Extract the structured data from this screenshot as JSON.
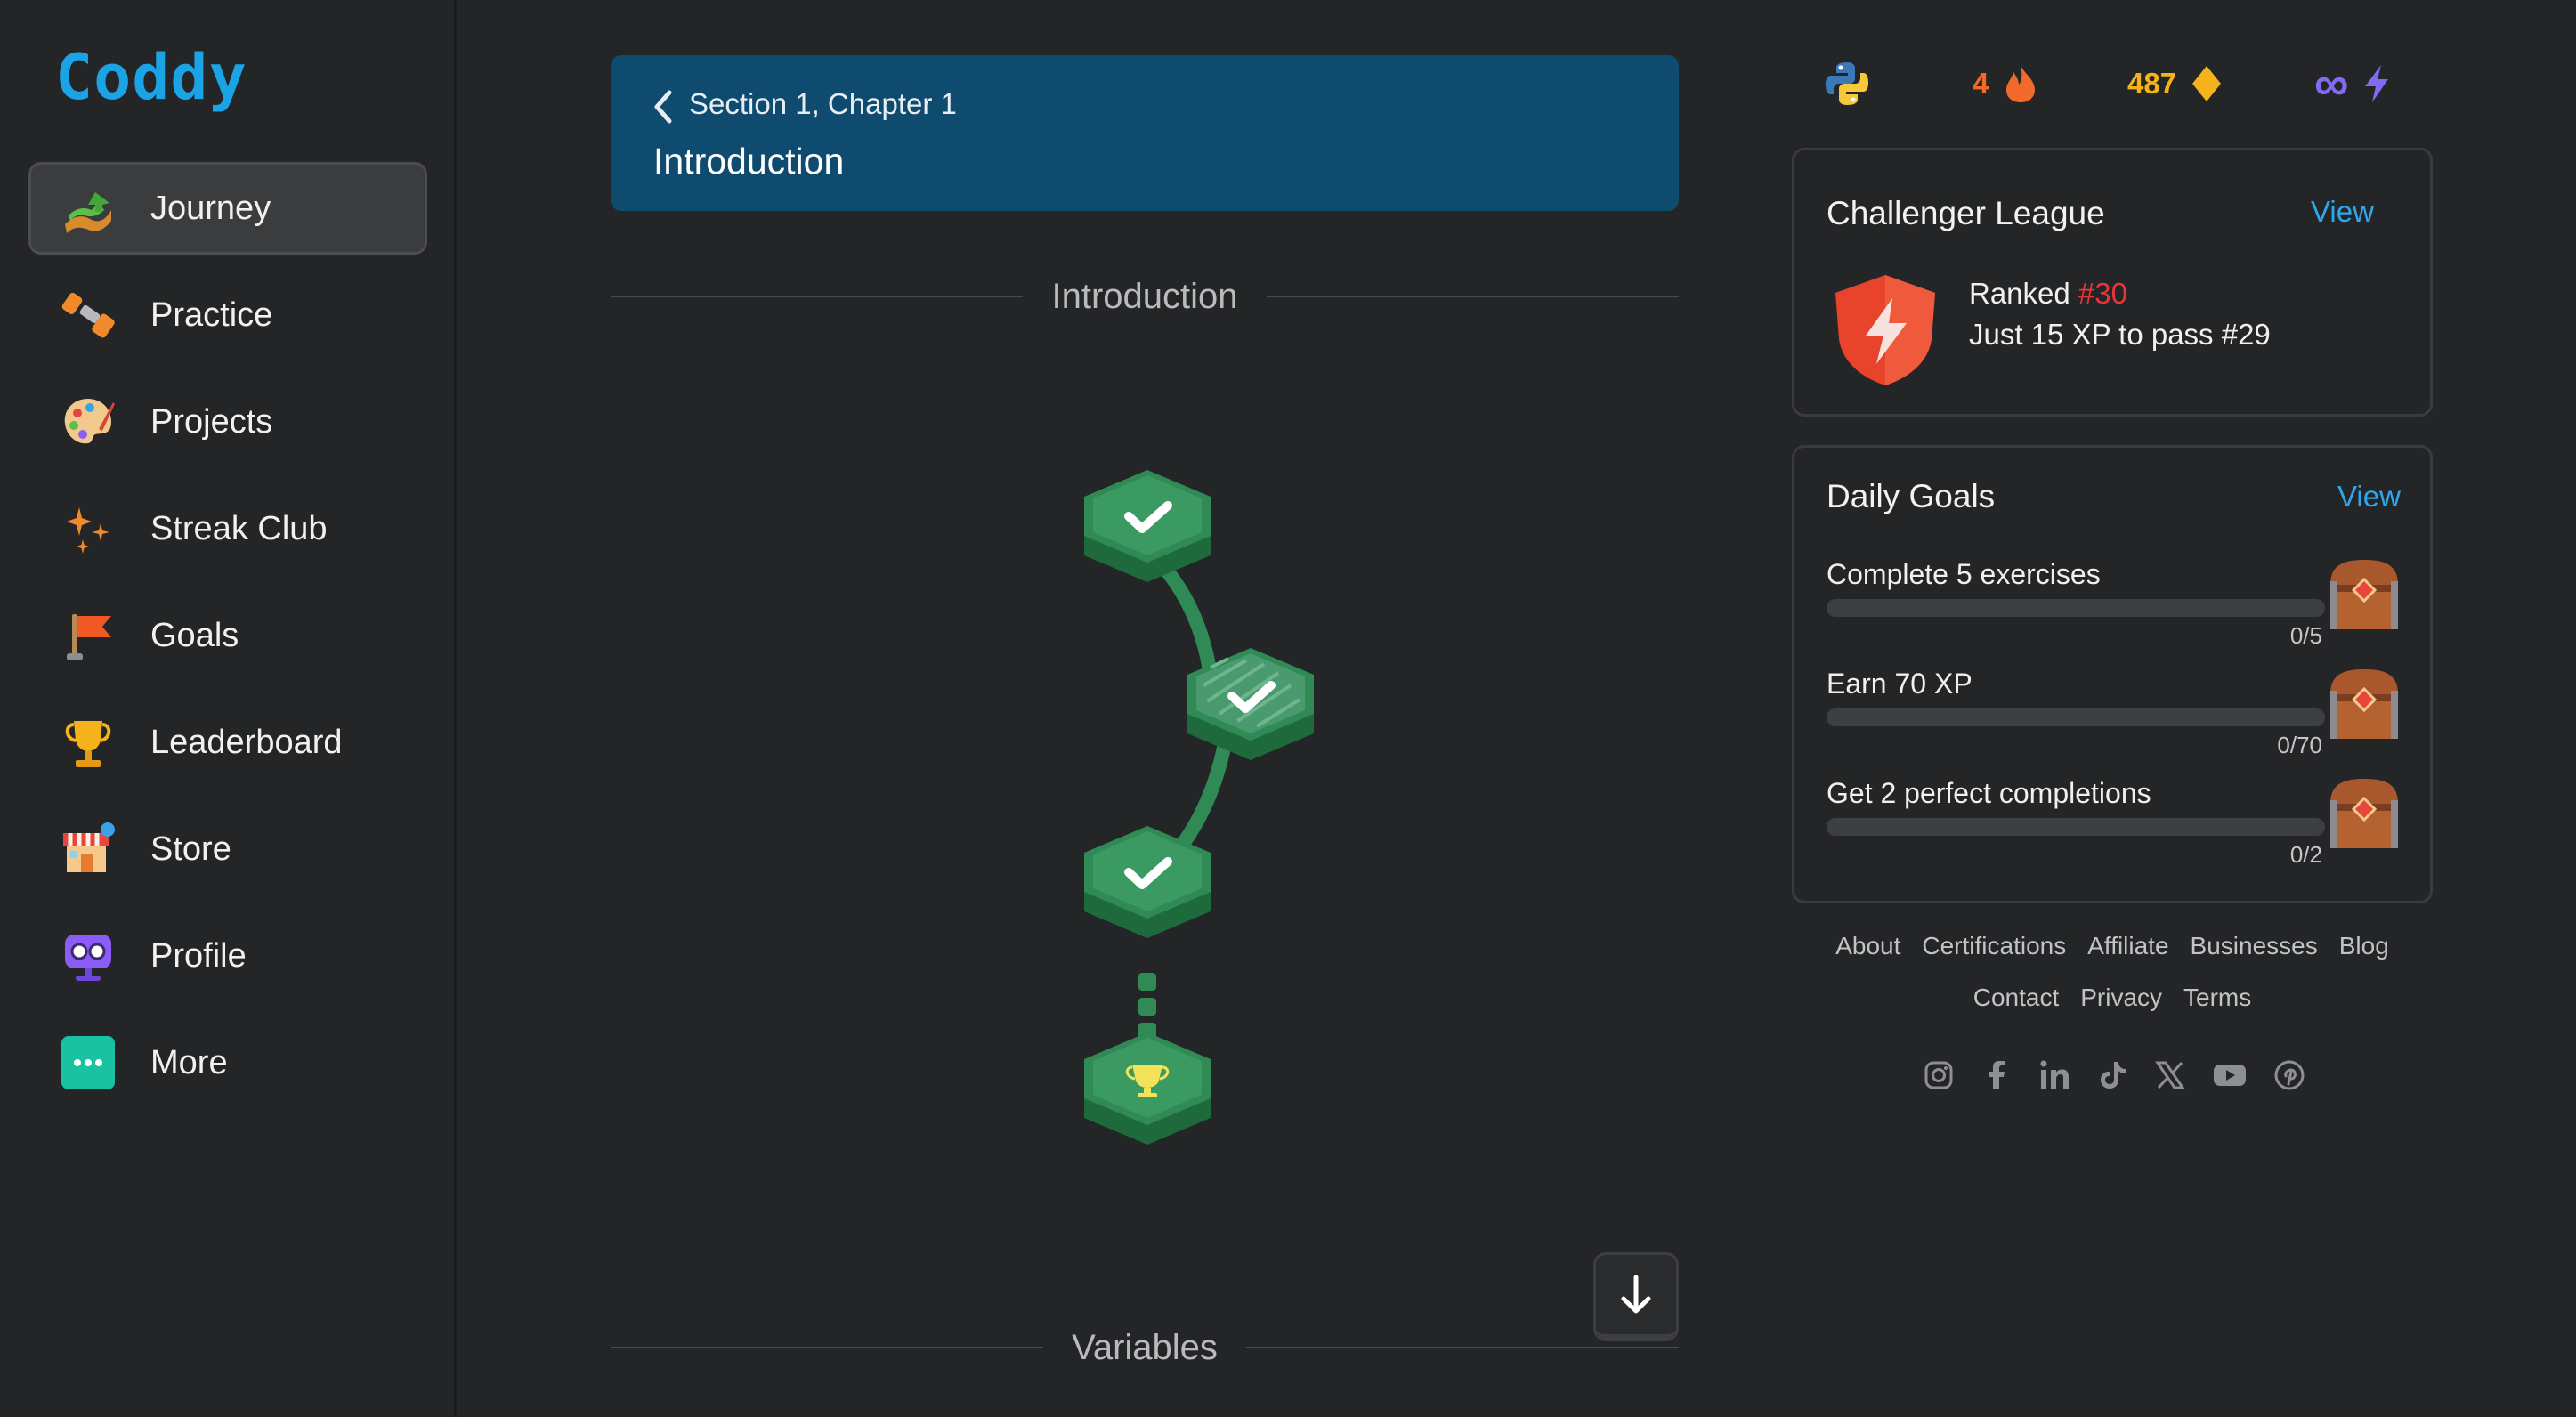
{
  "app": {
    "logo": "Coddy"
  },
  "sidebar": {
    "items": [
      {
        "label": "Journey",
        "icon": "journey-icon",
        "active": true
      },
      {
        "label": "Practice",
        "icon": "dumbbell-icon"
      },
      {
        "label": "Projects",
        "icon": "palette-icon"
      },
      {
        "label": "Streak Club",
        "icon": "sparkles-icon"
      },
      {
        "label": "Goals",
        "icon": "flag-icon"
      },
      {
        "label": "Leaderboard",
        "icon": "trophy-icon"
      },
      {
        "label": "Store",
        "icon": "store-icon"
      },
      {
        "label": "Profile",
        "icon": "robot-avatar-icon"
      },
      {
        "label": "More",
        "icon": "more-dots-icon"
      }
    ]
  },
  "chapter": {
    "section": "Section 1, Chapter 1",
    "title": "Introduction"
  },
  "path": {
    "section_title": "Introduction",
    "next_section_title": "Variables",
    "nodes": [
      {
        "state": "completed",
        "icon": "check-icon"
      },
      {
        "state": "completed-current",
        "icon": "check-icon"
      },
      {
        "state": "completed",
        "icon": "check-icon"
      },
      {
        "state": "reward",
        "icon": "trophy-icon"
      }
    ]
  },
  "stats": {
    "language_icon": "python-icon",
    "streak": "4",
    "gems": "487",
    "energy": "∞",
    "colors": {
      "streak": "#f26a2a",
      "gems": "#f6b21a",
      "energy": "#7f6cf2"
    }
  },
  "league": {
    "title": "Challenger League",
    "view_label": "View",
    "ranked_prefix": "Ranked",
    "rank": "#30",
    "subtitle": "Just 15 XP to pass #29"
  },
  "daily_goals": {
    "title": "Daily Goals",
    "view_label": "View",
    "goals": [
      {
        "label": "Complete 5 exercises",
        "count": "0/5",
        "progress": 0
      },
      {
        "label": "Earn 70 XP",
        "count": "0/70",
        "progress": 0
      },
      {
        "label": "Get 2 perfect completions",
        "count": "0/2",
        "progress": 0
      }
    ]
  },
  "footer": {
    "links_row1": [
      "About",
      "Certifications",
      "Affiliate",
      "Businesses",
      "Blog"
    ],
    "links_row2": [
      "Contact",
      "Privacy",
      "Terms"
    ],
    "socials": [
      "instagram-icon",
      "facebook-icon",
      "linkedin-icon",
      "tiktok-icon",
      "x-icon",
      "youtube-icon",
      "pinterest-icon"
    ]
  },
  "colors": {
    "accent": "#1aa4e6",
    "header_bg": "#0f4b6e",
    "node_green": "#2f8a55"
  }
}
